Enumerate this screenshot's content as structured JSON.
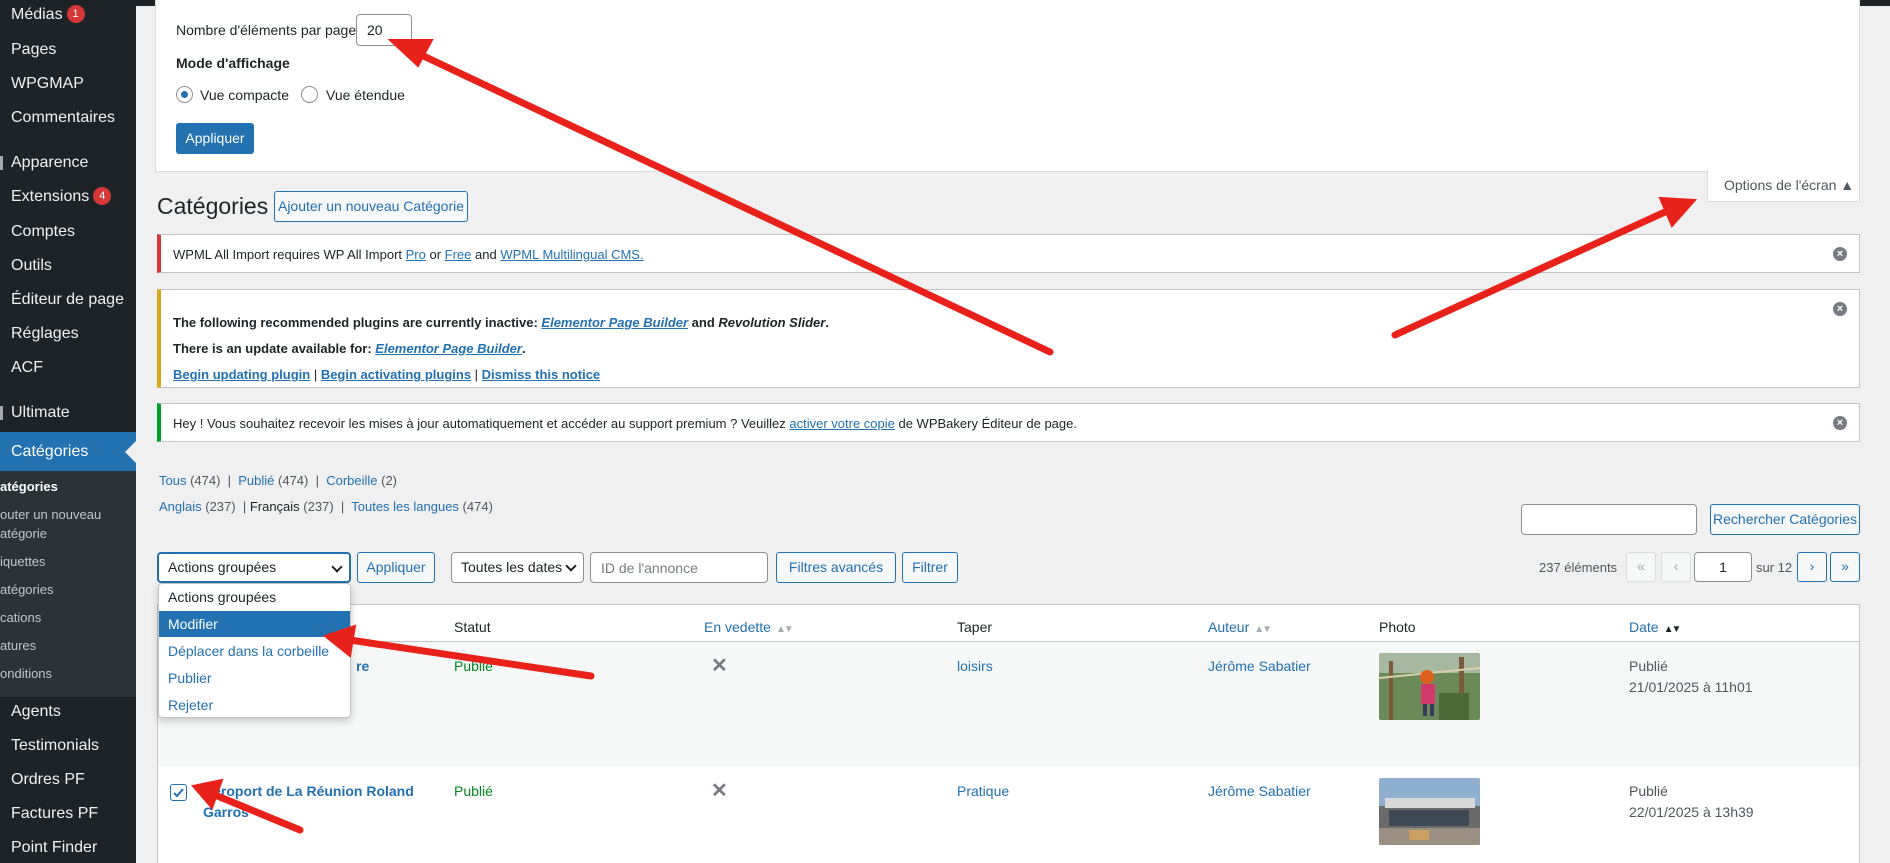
{
  "sidebar": {
    "items": [
      {
        "label": "Médias",
        "badge": "1"
      },
      {
        "label": "Pages"
      },
      {
        "label": "WPGMAP"
      },
      {
        "label": "Commentaires"
      },
      {
        "label": "Apparence"
      },
      {
        "label": "Extensions",
        "badge": "4"
      },
      {
        "label": "Comptes"
      },
      {
        "label": "Outils"
      },
      {
        "label": "Éditeur de page"
      },
      {
        "label": "Réglages"
      },
      {
        "label": "ACF"
      },
      {
        "label": "Ultimate"
      },
      {
        "label": "Catégories"
      },
      {
        "label": "Agents"
      },
      {
        "label": "Testimonials"
      },
      {
        "label": "Ordres PF"
      },
      {
        "label": "Factures PF"
      },
      {
        "label": "Point Finder"
      }
    ],
    "submenu": [
      "atégories",
      "outer un nouveau",
      "atégorie",
      "iquettes",
      "atégories",
      "cations",
      "atures",
      "onditions"
    ]
  },
  "screen_options": {
    "per_page_label": "Nombre d'éléments par page :",
    "per_page_value": "20",
    "display_mode_label": "Mode d'affichage",
    "compact_label": "Vue compacte",
    "extended_label": "Vue étendue",
    "apply_label": "Appliquer",
    "tab_label": "Options de l'écran ▲"
  },
  "page": {
    "title": "Catégories",
    "add_new_label": "Ajouter un nouveau Catégorie"
  },
  "notices": {
    "wpml": {
      "text1": "WPML All Import requires WP All Import ",
      "pro": "Pro",
      "or": " or ",
      "free": "Free",
      "and": " and ",
      "cms": "WPML Multilingual CMS."
    },
    "plugins": {
      "line1_pre": "The following recommended plugins are currently inactive: ",
      "elementor": "Elementor Page Builder",
      "line1_mid": " and ",
      "revslider": "Revolution Slider",
      "line1_end": ".",
      "line2_pre": "There is an update available for: ",
      "line2_end": ".",
      "begin_updating": "Begin updating plugin",
      "begin_activating": "Begin activating plugins",
      "dismiss": "Dismiss this notice",
      "sep": " | "
    },
    "wpbakery": {
      "pre": "Hey ! Vous souhaitez recevoir les mises à jour automatiquement et accéder au support premium ? Veuillez ",
      "link": "activer votre copie",
      "post": " de WPBakery Éditeur de page."
    }
  },
  "views": {
    "status": [
      {
        "label": "Tous",
        "count": " (474)"
      },
      {
        "label": "Publié",
        "count": " (474)"
      },
      {
        "label": "Corbeille",
        "count": " (2)"
      }
    ],
    "langs": [
      {
        "label": "Anglais",
        "count": " (237)"
      },
      {
        "label": "Français",
        "count": " (237)"
      },
      {
        "label": "Toutes les langues",
        "count": " (474)"
      }
    ]
  },
  "search": {
    "button_label": "Rechercher Catégories"
  },
  "tablenav": {
    "bulk_label": "Actions groupées",
    "apply_label": "Appliquer",
    "dates_label": "Toutes les dates",
    "id_placeholder": "ID de l'annonce",
    "advanced_label": "Filtres avancés",
    "filter_label": "Filtrer",
    "count_label": "237 éléments",
    "first": "«",
    "prev": "‹",
    "current_page": "1",
    "of_label": "sur 12",
    "next": "›",
    "last": "»"
  },
  "bulk_menu": [
    "Actions groupées",
    "Modifier",
    "Déplacer dans la corbeille",
    "Publier",
    "Rejeter"
  ],
  "table": {
    "columns": {
      "status": "Statut",
      "featured": "En vedette",
      "type": "Taper",
      "author": "Auteur",
      "photo": "Photo",
      "date": "Date"
    },
    "rows": [
      {
        "title": "re",
        "status": "Publié",
        "featured": "✕",
        "type": "loisirs",
        "author": "Jérôme Sabatier",
        "date_status": "Publié",
        "date": "21/01/2025 à 11h01"
      },
      {
        "title": "Aéroport de La Réunion Roland",
        "title2": "Garros",
        "status": "Publié",
        "featured": "✕",
        "type": "Pratique",
        "author": "Jérôme Sabatier",
        "date_status": "Publié",
        "date": "22/01/2025 à 13h39"
      }
    ]
  },
  "colors": {
    "accent": "#2271b1",
    "sidebar": "#1d2327",
    "annotation": "#e8211a"
  }
}
